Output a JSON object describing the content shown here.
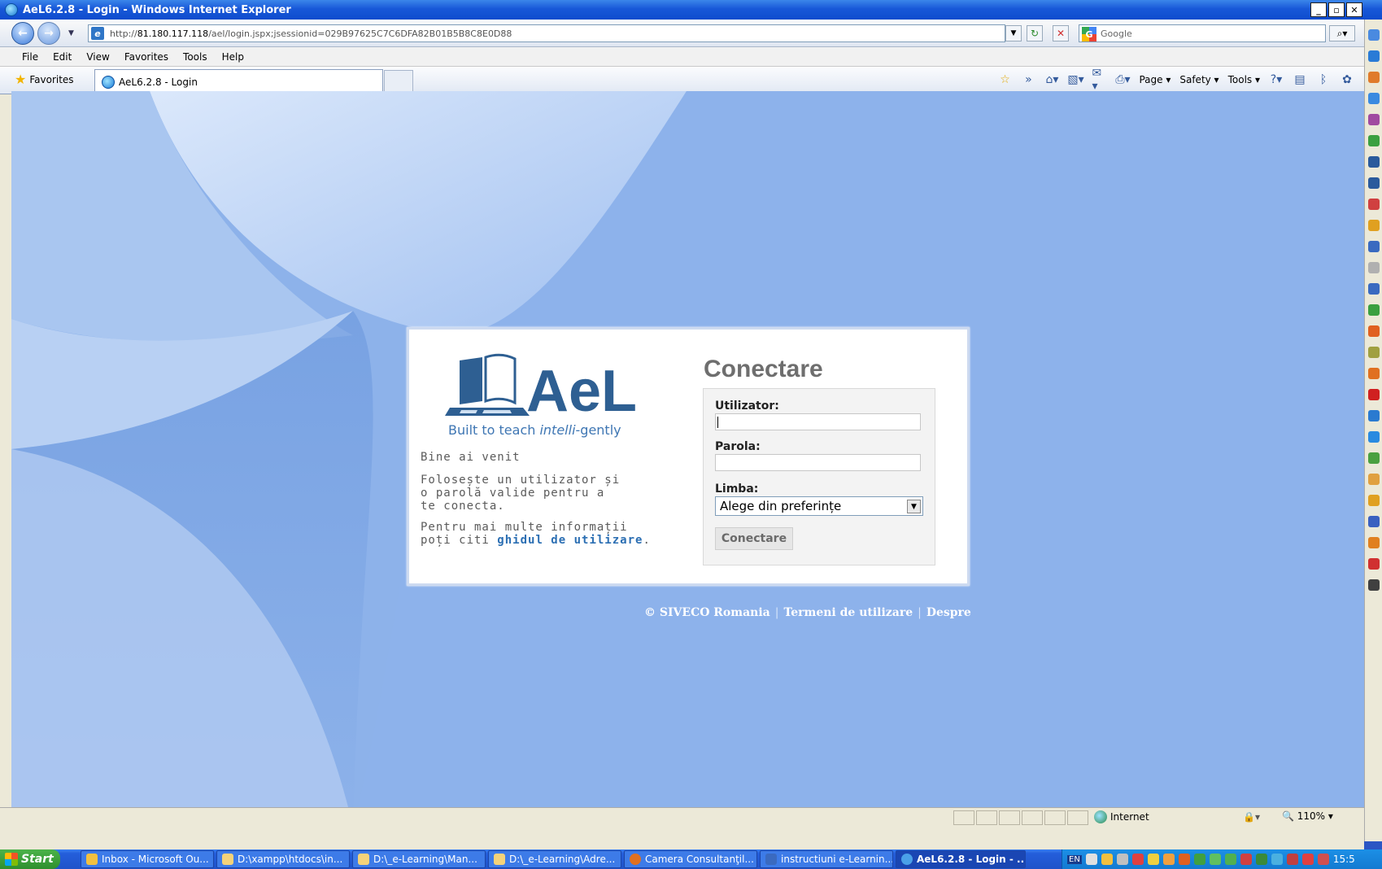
{
  "window": {
    "title": "AeL6.2.8 - Login - Windows Internet Explorer"
  },
  "address": {
    "url_gray_prefix": "http://",
    "url_host": "81.180.117.118",
    "url_path": "/ael/login.jspx;jsessionid=029B97625C7C6DFA82B01B5B8C8E0D88",
    "search_placeholder": "Google"
  },
  "menu": [
    "File",
    "Edit",
    "View",
    "Favorites",
    "Tools",
    "Help"
  ],
  "favorites_label": "Favorites",
  "tab_title": "AeL6.2.8 - Login",
  "commands": {
    "page": "Page ▾",
    "safety": "Safety ▾",
    "tools": "Tools ▾"
  },
  "login": {
    "logo_text": "AeL",
    "tagline_plain": "Built to teach ",
    "tagline_italic": "intelli",
    "tagline_rest": "-gently",
    "welcome": "Bine ai venit",
    "instructions": "Folosește un utilizator și o parolă valide pentru a te conecta.",
    "info_prefix": "Pentru mai multe informații poți citi",
    "info_link": "ghidul de utilizare",
    "info_suffix": ".",
    "title": "Conectare",
    "user_label": "Utilizator:",
    "user_value": "",
    "password_label": "Parola:",
    "password_value": "",
    "language_label": "Limba:",
    "language_selected": "Alege din preferințe",
    "submit_label": "Conectare"
  },
  "footer": {
    "copyright": "© SIVECO Romania",
    "separator": "|",
    "terms": "Termeni de utilizare",
    "about": "Despre"
  },
  "status": {
    "zone": "Internet",
    "zoom": "110%"
  },
  "taskbar": {
    "start": "Start",
    "tasks": [
      {
        "label": "Inbox - Microsoft Ou...",
        "active": false
      },
      {
        "label": "D:\\xampp\\htdocs\\in...",
        "active": false
      },
      {
        "label": "D:\\_e-Learning\\Man...",
        "active": false
      },
      {
        "label": "D:\\_e-Learning\\Adre...",
        "active": false
      },
      {
        "label": "Camera Consultanţil...",
        "active": false
      },
      {
        "label": "instructiuni e-Learnin...",
        "active": false
      },
      {
        "label": "AeL6.2.8 - Login - ...",
        "active": true
      }
    ],
    "lang": "EN",
    "clock": "15:5"
  },
  "colors": {
    "ie_blue": "#1858d8",
    "content_bg": "#8db2ea",
    "link_blue": "#2c6fb3",
    "title_gray": "#6e6e6e"
  }
}
